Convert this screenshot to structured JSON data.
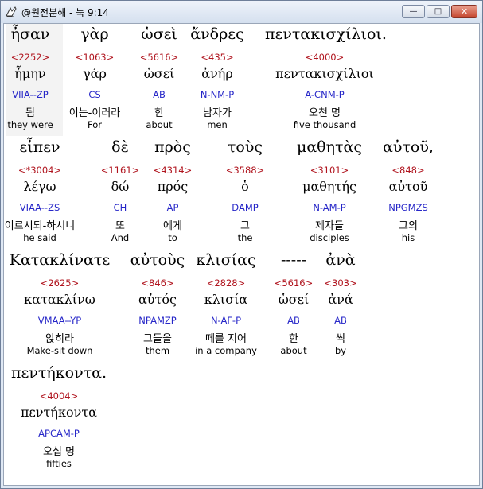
{
  "window": {
    "title": "@원전분해 - 눅 9:14",
    "buttons": {
      "minimize": "—",
      "maximize": "□",
      "close": "✕"
    }
  },
  "words": [
    {
      "greek": "ἦσαν",
      "strong": "<2252>",
      "lemma": "ἦμην",
      "parsing": "VIIA--ZP",
      "korean": "됨",
      "english": "they were",
      "selected": true
    },
    {
      "greek": "γὰρ",
      "strong": "<1063>",
      "lemma": "γάρ",
      "parsing": "CS",
      "korean": "이는-이러라",
      "english": "For"
    },
    {
      "greek": "ὡσεὶ",
      "strong": "<5616>",
      "lemma": "ὡσεί",
      "parsing": "AB",
      "korean": "한",
      "english": "about"
    },
    {
      "greek": "ἄνδρες",
      "strong": "<435>",
      "lemma": "ἀνήρ",
      "parsing": "N-NM-P",
      "korean": "남자가",
      "english": "men"
    },
    {
      "greek": "πεντακισχίλιοι.",
      "strong": "<4000>",
      "lemma": "πεντακισχίλιοι",
      "parsing": "A-CNM-P",
      "korean": "오천 명",
      "english": "five thousand"
    },
    {
      "greek": "εἶπεν",
      "strong": "<*3004>",
      "lemma": "λέγω",
      "parsing": "VIAA--ZS",
      "korean": "이르시되-하시니",
      "english": "he said"
    },
    {
      "greek": "δὲ",
      "strong": "<1161>",
      "lemma": "δώ",
      "parsing": "CH",
      "korean": "또",
      "english": "And"
    },
    {
      "greek": "πρὸς",
      "strong": "<4314>",
      "lemma": "πρός",
      "parsing": "AP",
      "korean": "에게",
      "english": "to"
    },
    {
      "greek": "τοὺς",
      "strong": "<3588>",
      "lemma": "ὁ",
      "parsing": "DAMP",
      "korean": "그",
      "english": "the"
    },
    {
      "greek": "μαθητὰς",
      "strong": "<3101>",
      "lemma": "μαθητής",
      "parsing": "N-AM-P",
      "korean": "제자들",
      "english": "disciples"
    },
    {
      "greek": "αὐτοῦ,",
      "strong": "<848>",
      "lemma": "αὐτοῦ",
      "parsing": "NPGMZS",
      "korean": "그의",
      "english": "his"
    },
    {
      "greek": "Κατακλίνατε",
      "strong": "<2625>",
      "lemma": "κατακλίνω",
      "parsing": "VMAA--YP",
      "korean": "앉히라",
      "english": "Make-sit down"
    },
    {
      "greek": "αὐτοὺς",
      "strong": "<846>",
      "lemma": "αὐτός",
      "parsing": "NPAMZP",
      "korean": "그들을",
      "english": "them"
    },
    {
      "greek": "κλισίας",
      "strong": "<2828>",
      "lemma": "κλισία",
      "parsing": "N-AF-P",
      "korean": "떼를 지어",
      "english": "in a company"
    },
    {
      "greek": "-----",
      "strong": "<5616>",
      "lemma": "ὡσεί",
      "parsing": "AB",
      "korean": "한",
      "english": "about"
    },
    {
      "greek": "ἀνὰ",
      "strong": "<303>",
      "lemma": "ἀνά",
      "parsing": "AB",
      "korean": "씩",
      "english": "by"
    },
    {
      "greek": "πεντήκοντα.",
      "strong": "<4004>",
      "lemma": "πεντήκοντα",
      "parsing": "APCAM-P",
      "korean": "오십 명",
      "english": "fifties"
    }
  ]
}
